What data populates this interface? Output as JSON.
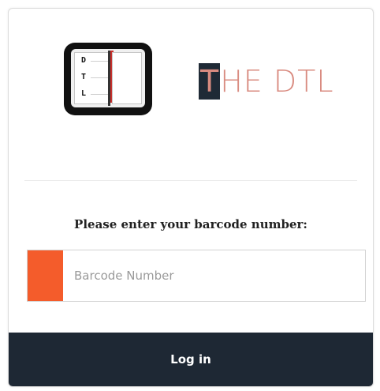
{
  "logo": {
    "book_icon_letters": [
      "D",
      "T",
      "L"
    ],
    "brand_first_letter": "T",
    "brand_rest": "HE DTL"
  },
  "login_form": {
    "prompt": "Please enter your barcode number:",
    "barcode_placeholder": "Barcode Number",
    "barcode_value": "",
    "login_label": "Log in"
  },
  "colors": {
    "accent": "#f45c2b",
    "dark": "#1e2834",
    "brand_text": "#d98b80"
  }
}
